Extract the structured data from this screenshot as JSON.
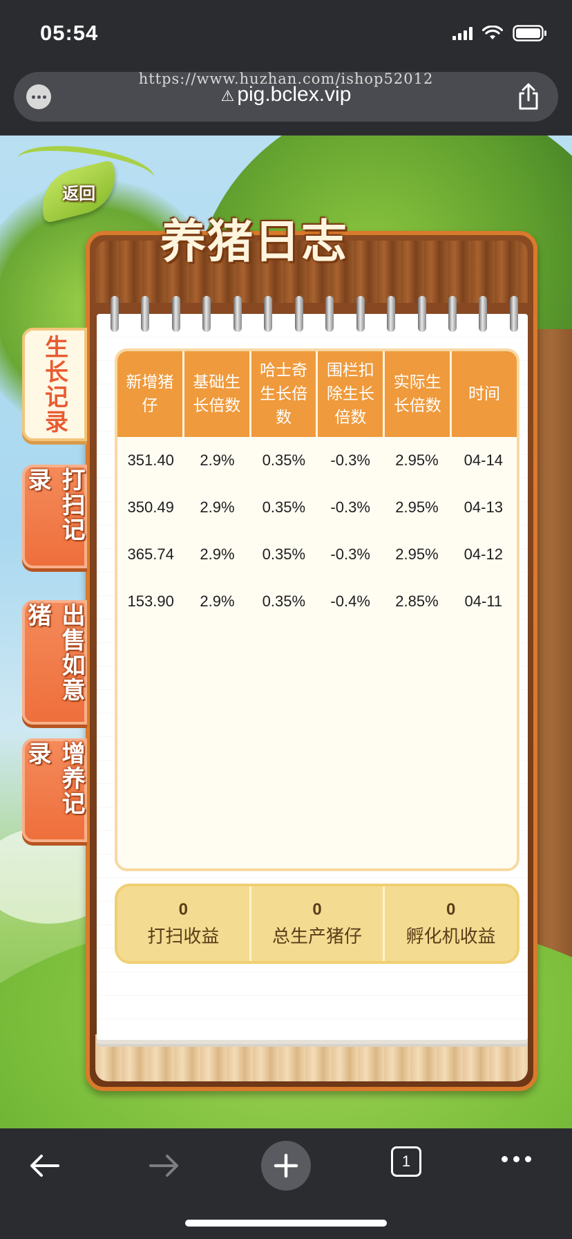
{
  "status_bar": {
    "time": "05:54"
  },
  "browser": {
    "watermark": "https://www.huzhan.com/ishop52012",
    "domain": "pig.bclex.vip",
    "tab_count": "1"
  },
  "game": {
    "back_label": "返回",
    "title": "养猪日志",
    "side_tabs": [
      {
        "label": "生长记录",
        "active": true
      },
      {
        "label": "打扫记录",
        "active": false
      },
      {
        "label": "出售如意猪",
        "active": false
      },
      {
        "label": "增养记录",
        "active": false
      }
    ],
    "table": {
      "headers": [
        "新增猪仔",
        "基础生长倍数",
        "哈士奇生长倍数",
        "围栏扣除生长倍数",
        "实际生长倍数",
        "时间"
      ],
      "rows": [
        [
          "351.40",
          "2.9%",
          "0.35%",
          "-0.3%",
          "2.95%",
          "04-14"
        ],
        [
          "350.49",
          "2.9%",
          "0.35%",
          "-0.3%",
          "2.95%",
          "04-13"
        ],
        [
          "365.74",
          "2.9%",
          "0.35%",
          "-0.3%",
          "2.95%",
          "04-12"
        ],
        [
          "153.90",
          "2.9%",
          "0.35%",
          "-0.4%",
          "2.85%",
          "04-11"
        ]
      ]
    },
    "summary": [
      {
        "value": "0",
        "label": "打扫收益"
      },
      {
        "value": "0",
        "label": "总生产猪仔"
      },
      {
        "value": "0",
        "label": "孵化机收益"
      }
    ]
  }
}
